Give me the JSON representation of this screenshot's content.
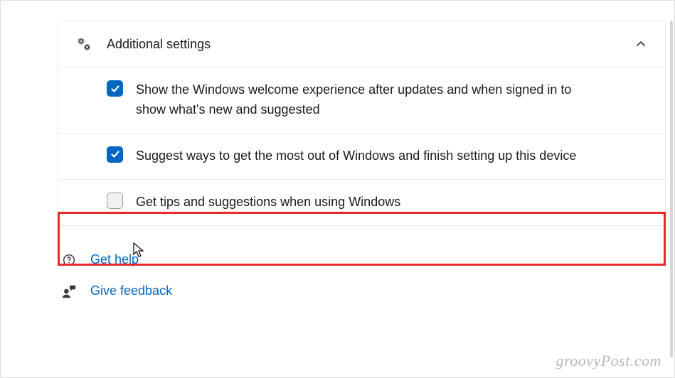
{
  "panel": {
    "title": "Additional settings",
    "expanded": true,
    "items": [
      {
        "label": "Show the Windows welcome experience after updates and when signed in to show what's new and suggested",
        "checked": true
      },
      {
        "label": "Suggest ways to get the most out of Windows and finish setting up this device",
        "checked": true
      },
      {
        "label": "Get tips and suggestions when using Windows",
        "checked": false
      }
    ]
  },
  "links": {
    "help": "Get help",
    "feedback": "Give feedback"
  },
  "watermark": "groovyPost.com"
}
